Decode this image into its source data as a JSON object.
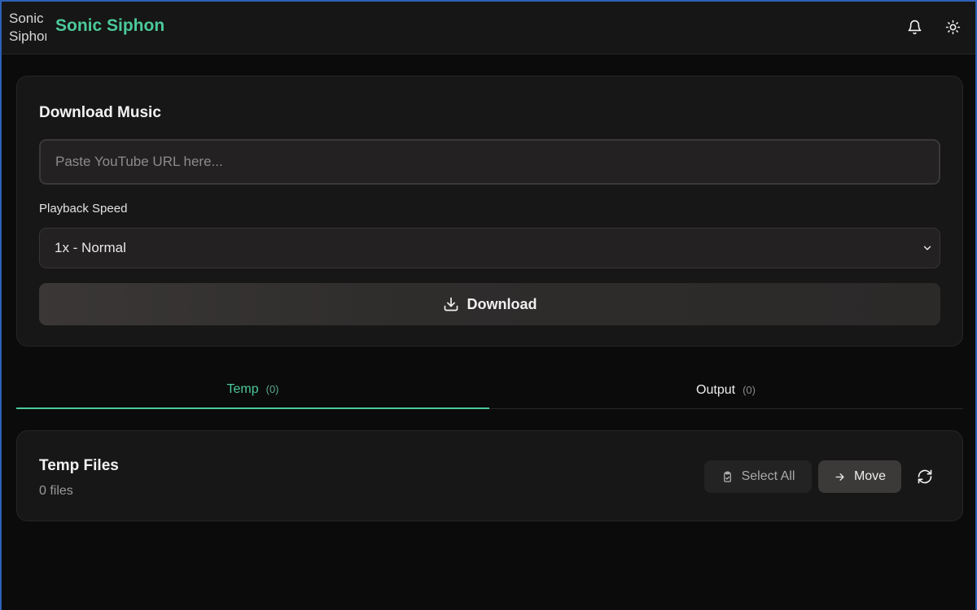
{
  "header": {
    "logo_alt": "Sonic Siphon",
    "title": "Sonic Siphon"
  },
  "download": {
    "title": "Download Music",
    "url_placeholder": "Paste YouTube URL here...",
    "url_value": "",
    "speed_label": "Playback Speed",
    "speed_selected": "1x - Normal",
    "download_label": "Download"
  },
  "tabs": [
    {
      "label": "Temp",
      "count": "(0)",
      "active": true
    },
    {
      "label": "Output",
      "count": "(0)",
      "active": false
    }
  ],
  "files": {
    "title": "Temp Files",
    "count_text": "0 files",
    "select_all_label": "Select All",
    "move_label": "Move"
  },
  "colors": {
    "accent": "#4cc99a",
    "background": "#0b0b0b",
    "card": "#181717",
    "window_border": "#2d5fb8"
  },
  "icons": {
    "notifications": "bell-icon",
    "theme": "sun-icon",
    "download": "download-icon",
    "select_all": "clipboard-check-icon",
    "move": "arrow-right-icon",
    "refresh": "refresh-icon",
    "select": "chevron-down-icon"
  }
}
